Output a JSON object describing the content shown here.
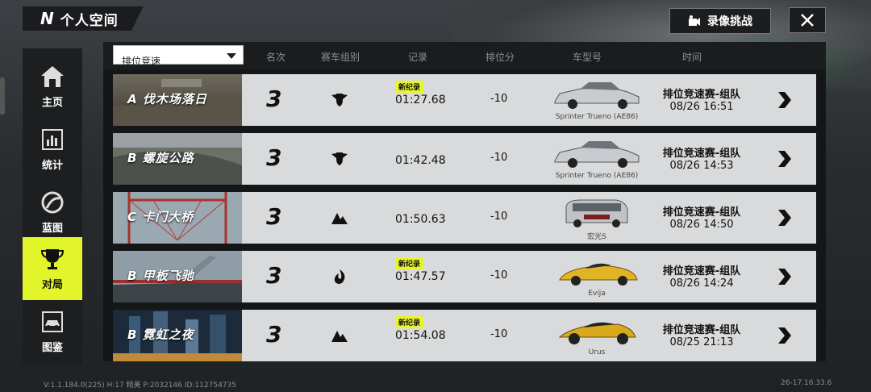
{
  "header": {
    "logo": "N",
    "title": "个人空间"
  },
  "top_actions": {
    "record_label": "录像挑战",
    "close_icon": "close-icon"
  },
  "sidebar": {
    "items": [
      {
        "label": "主页",
        "icon": "home-icon",
        "active": false
      },
      {
        "label": "统计",
        "icon": "stats-icon",
        "active": false
      },
      {
        "label": "蓝图",
        "icon": "blueprint-icon",
        "active": false
      },
      {
        "label": "对局",
        "icon": "trophy-icon",
        "active": true
      },
      {
        "label": "图鉴",
        "icon": "car-collection-icon",
        "active": false
      }
    ]
  },
  "filter": {
    "selected": "排位竞速"
  },
  "columns": [
    "名次",
    "赛车组别",
    "记录",
    "排位分",
    "车型号",
    "时间"
  ],
  "rows": [
    {
      "grade": "A",
      "track": "伐木场落日",
      "rank": "3",
      "group_icon": "shield-wings-icon",
      "new_record": "新纪录",
      "time": "01:27.68",
      "points": "-10",
      "car_name": "Sprinter Trueno (AE86)",
      "mode": "排位竞速赛-组队",
      "date": "08/26  16:51"
    },
    {
      "grade": "B",
      "track": "螺旋公路",
      "rank": "3",
      "group_icon": "shield-wings-icon",
      "new_record": "",
      "time": "01:42.48",
      "points": "-10",
      "car_name": "Sprinter Trueno (AE86)",
      "mode": "排位竞速赛-组队",
      "date": "08/26  14:53"
    },
    {
      "grade": "C",
      "track": "卡门大桥",
      "rank": "3",
      "group_icon": "mountain-icon",
      "new_record": "",
      "time": "01:50.63",
      "points": "-10",
      "car_name": "宏光S",
      "mode": "排位竞速赛-组队",
      "date": "08/26  14:50"
    },
    {
      "grade": "B",
      "track": "甲板飞驰",
      "rank": "3",
      "group_icon": "flame-icon",
      "new_record": "新纪录",
      "time": "01:47.57",
      "points": "-10",
      "car_name": "Evija",
      "mode": "排位竞速赛-组队",
      "date": "08/26  14:24"
    },
    {
      "grade": "B",
      "track": "霓虹之夜",
      "rank": "3",
      "group_icon": "mountain-icon",
      "new_record": "新纪录",
      "time": "01:54.08",
      "points": "-10",
      "car_name": "Urus",
      "mode": "排位竞速赛-组队",
      "date": "08/25  21:13"
    }
  ],
  "footer": {
    "version": "V:1.1.184.0(225) H:17 精美 P:2032146 ID:112754735",
    "build": "26-17.16.33.6"
  }
}
